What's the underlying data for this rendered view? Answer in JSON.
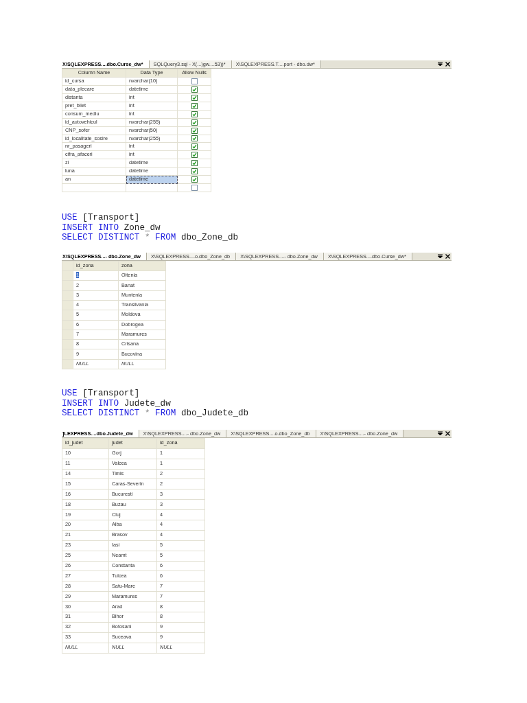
{
  "sections": [
    {
      "kind": "designer",
      "tabs": [
        {
          "label": "X\\SQLEXPRESS....dbo.Curse_dw*",
          "selected": true
        },
        {
          "label": "SQLQuery3.sql - X(...)gw....53))*",
          "selected": false
        },
        {
          "label": "X\\SQLEXPRESS.T....port - dbo.dw*",
          "selected": false
        }
      ],
      "columns": [
        "Column Name",
        "Data Type",
        "Allow Nulls"
      ],
      "rows": [
        {
          "name": "id_cursa",
          "type": "nvarchar(10)",
          "allow_nulls": false,
          "selected": false
        },
        {
          "name": "data_plecare",
          "type": "datetime",
          "allow_nulls": true,
          "selected": false
        },
        {
          "name": "distanta",
          "type": "int",
          "allow_nulls": true,
          "selected": false
        },
        {
          "name": "pret_bilet",
          "type": "int",
          "allow_nulls": true,
          "selected": false
        },
        {
          "name": "consum_mediu",
          "type": "int",
          "allow_nulls": true,
          "selected": false
        },
        {
          "name": "id_autovehicul",
          "type": "nvarchar(255)",
          "allow_nulls": true,
          "selected": false
        },
        {
          "name": "CNP_sofer",
          "type": "nvarchar(50)",
          "allow_nulls": true,
          "selected": false
        },
        {
          "name": "id_localitate_sosire",
          "type": "nvarchar(255)",
          "allow_nulls": true,
          "selected": false
        },
        {
          "name": "nr_pasageri",
          "type": "int",
          "allow_nulls": true,
          "selected": false
        },
        {
          "name": "cifra_afaceri",
          "type": "int",
          "allow_nulls": true,
          "selected": false
        },
        {
          "name": "zi",
          "type": "datetime",
          "allow_nulls": true,
          "selected": false
        },
        {
          "name": "luna",
          "type": "datetime",
          "allow_nulls": true,
          "selected": false
        },
        {
          "name": "an",
          "type": "datetime",
          "allow_nulls": true,
          "selected": true
        },
        {
          "allow_nulls": false,
          "selected": false
        }
      ]
    },
    {
      "kind": "code",
      "lines": [
        [
          {
            "text": "USE",
            "kind": "keyword"
          },
          {
            "text": "[Transport]",
            "kind": "plain"
          }
        ],
        [
          {
            "text": "INSERT",
            "kind": "keyword"
          },
          {
            "text": "INTO",
            "kind": "keyword"
          },
          {
            "text": "Zone_dw",
            "kind": "plain"
          }
        ],
        [
          {
            "text": "SELECT",
            "kind": "keyword"
          },
          {
            "text": "DISTINCT",
            "kind": "keyword"
          },
          {
            "text": "*",
            "kind": "operator"
          },
          {
            "text": "FROM",
            "kind": "keyword"
          },
          {
            "text": "dbo_Zone_db",
            "kind": "plain"
          }
        ]
      ]
    },
    {
      "kind": "results",
      "row_selectors": true,
      "tabs": [
        {
          "label": "X\\SQLEXPRESS...- dbo.Zone_dw",
          "selected": true
        },
        {
          "label": "X\\SQLEXPRESS....o.dbo_Zone_db",
          "selected": false
        },
        {
          "label": "X\\SQLEXPRESS....- dbo.Zone_dw",
          "selected": false
        },
        {
          "label": "X\\SQLEXPRESS....dbo.Curse_dw*",
          "selected": false
        }
      ],
      "columns": [
        "id_zona",
        "zona"
      ],
      "rows": [
        {
          "cells": [
            "1",
            "Oltenia"
          ],
          "kind": "data",
          "selected": true
        },
        {
          "cells": [
            "2",
            "Banat"
          ],
          "kind": "data",
          "selected": false
        },
        {
          "cells": [
            "3",
            "Muntenia"
          ],
          "kind": "data",
          "selected": false
        },
        {
          "cells": [
            "4",
            "Transilvania"
          ],
          "kind": "data",
          "selected": false
        },
        {
          "cells": [
            "5",
            "Moldova"
          ],
          "kind": "data",
          "selected": false
        },
        {
          "cells": [
            "6",
            "Dobrogea"
          ],
          "kind": "data",
          "selected": false
        },
        {
          "cells": [
            "7",
            "Maramures"
          ],
          "kind": "data",
          "selected": false
        },
        {
          "cells": [
            "8",
            "Crisana"
          ],
          "kind": "data",
          "selected": false
        },
        {
          "cells": [
            "9",
            "Bucovina"
          ],
          "kind": "data",
          "selected": false
        },
        {
          "cells": [
            "NULL",
            "NULL"
          ],
          "kind": "null",
          "selected": false
        }
      ]
    },
    {
      "kind": "code",
      "lines": [
        [
          {
            "text": "USE",
            "kind": "keyword"
          },
          {
            "text": "[Transport]",
            "kind": "plain"
          }
        ],
        [
          {
            "text": "INSERT",
            "kind": "keyword"
          },
          {
            "text": "INTO",
            "kind": "keyword"
          },
          {
            "text": "Judete_dw",
            "kind": "plain"
          }
        ],
        [
          {
            "text": "SELECT",
            "kind": "keyword"
          },
          {
            "text": "DISTINCT",
            "kind": "keyword"
          },
          {
            "text": "*",
            "kind": "operator"
          },
          {
            "text": "FROM",
            "kind": "keyword"
          },
          {
            "text": "dbo_Judete_db",
            "kind": "plain"
          }
        ]
      ]
    },
    {
      "kind": "results",
      "row_selectors": false,
      "tabs": [
        {
          "label": "]LEXPRESS....dbo.Judete_dw",
          "selected": true
        },
        {
          "label": "X\\SQLEXPRESS....- dbo.Zone_dw",
          "selected": false
        },
        {
          "label": "X\\SQLEXPRESS....o.dbo_Zone_db",
          "selected": false
        },
        {
          "label": "X\\SQLEXPRESS....- dbo.Zone_dw",
          "selected": false
        }
      ],
      "columns": [
        "id_judet",
        "judet",
        "id_zona"
      ],
      "rows": [
        {
          "cells": [
            "10",
            "Gorj",
            "1"
          ],
          "kind": "data",
          "selected": false
        },
        {
          "cells": [
            "11",
            "Valcea",
            "1"
          ],
          "kind": "data",
          "selected": false
        },
        {
          "cells": [
            "14",
            "Timis",
            "2"
          ],
          "kind": "data",
          "selected": false
        },
        {
          "cells": [
            "15",
            "Caras-Severin",
            "2"
          ],
          "kind": "data",
          "selected": false
        },
        {
          "cells": [
            "16",
            "Bucuresti",
            "3"
          ],
          "kind": "data",
          "selected": false
        },
        {
          "cells": [
            "18",
            "Buzau",
            "3"
          ],
          "kind": "data",
          "selected": false
        },
        {
          "cells": [
            "19",
            "Cluj",
            "4"
          ],
          "kind": "data",
          "selected": false
        },
        {
          "cells": [
            "20",
            "Alba",
            "4"
          ],
          "kind": "data",
          "selected": false
        },
        {
          "cells": [
            "21",
            "Brasov",
            "4"
          ],
          "kind": "data",
          "selected": false
        },
        {
          "cells": [
            "23",
            "Iasi",
            "5"
          ],
          "kind": "data",
          "selected": false
        },
        {
          "cells": [
            "25",
            "Neamt",
            "5"
          ],
          "kind": "data",
          "selected": false
        },
        {
          "cells": [
            "26",
            "Constanta",
            "6"
          ],
          "kind": "data",
          "selected": false
        },
        {
          "cells": [
            "27",
            "Tulcea",
            "6"
          ],
          "kind": "data",
          "selected": false
        },
        {
          "cells": [
            "28",
            "Satu-Mare",
            "7"
          ],
          "kind": "data",
          "selected": false
        },
        {
          "cells": [
            "29",
            "Maramures",
            "7"
          ],
          "kind": "data",
          "selected": false
        },
        {
          "cells": [
            "30",
            "Arad",
            "8"
          ],
          "kind": "data",
          "selected": false
        },
        {
          "cells": [
            "31",
            "Bihor",
            "8"
          ],
          "kind": "data",
          "selected": false
        },
        {
          "cells": [
            "32",
            "Botosani",
            "9"
          ],
          "kind": "data",
          "selected": false
        },
        {
          "cells": [
            "33",
            "Suceava",
            "9"
          ],
          "kind": "data",
          "selected": false
        },
        {
          "cells": [
            "NULL",
            "NULL",
            "NULL"
          ],
          "kind": "null",
          "selected": false
        }
      ]
    }
  ]
}
